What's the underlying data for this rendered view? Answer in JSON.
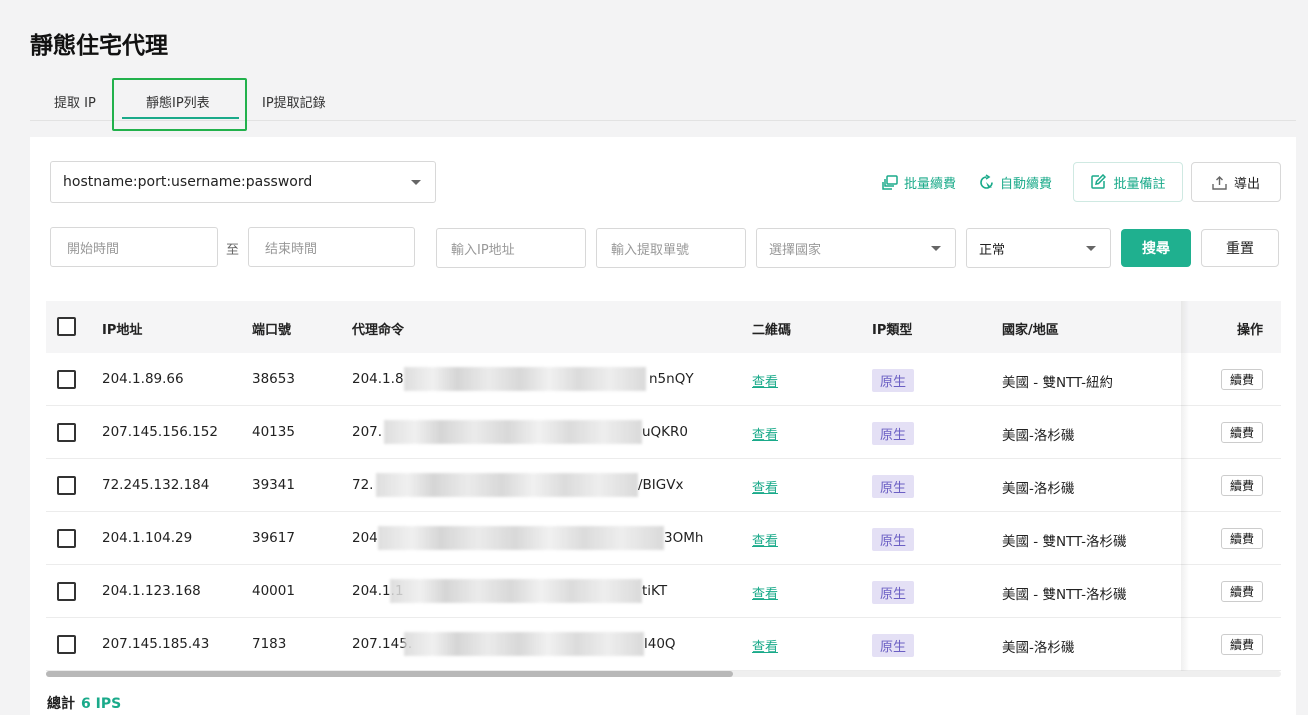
{
  "page": {
    "title": "靜態住宅代理"
  },
  "tabs": [
    {
      "label": "提取 IP"
    },
    {
      "label": "靜態IP列表"
    },
    {
      "label": "IP提取記錄"
    }
  ],
  "toolbar": {
    "format_select": "hostname:port:username:password",
    "bulk_renew": "批量續費",
    "auto_renew": "自動續費",
    "bulk_note": "批量備註",
    "export": "導出"
  },
  "filters": {
    "start_time_placeholder": "開始時間",
    "range_sep": "至",
    "end_time_placeholder": "结束時間",
    "ip_placeholder": "輸入IP地址",
    "order_placeholder": "輸入提取單號",
    "country_placeholder": "選擇國家",
    "status_value": "正常",
    "search": "搜尋",
    "reset": "重置"
  },
  "table": {
    "headers": {
      "ip": "IP地址",
      "port": "端口號",
      "command": "代理命令",
      "qr": "二維碼",
      "ip_type": "IP類型",
      "region": "國家/地區",
      "action": "操作"
    },
    "rows": [
      {
        "ip": "204.1.89.66",
        "port": "38653",
        "cmd_start": "204.1.8",
        "cmd_end": "n5nQY",
        "qr": "查看",
        "type": "原生",
        "region": "美國 - 雙NTT-紐約",
        "action": "續費"
      },
      {
        "ip": "207.145.156.152",
        "port": "40135",
        "cmd_start": "207.",
        "cmd_end": "uQKR0",
        "qr": "查看",
        "type": "原生",
        "region": "美國-洛杉磯",
        "action": "續費"
      },
      {
        "ip": "72.245.132.184",
        "port": "39341",
        "cmd_start": "72.",
        "cmd_end": "/BIGVx",
        "qr": "查看",
        "type": "原生",
        "region": "美國-洛杉磯",
        "action": "續費"
      },
      {
        "ip": "204.1.104.29",
        "port": "39617",
        "cmd_start": "204",
        "cmd_end": "3OMh",
        "qr": "查看",
        "type": "原生",
        "region": "美國 - 雙NTT-洛杉磯",
        "action": "續費"
      },
      {
        "ip": "204.1.123.168",
        "port": "40001",
        "cmd_start": "204.1.1",
        "cmd_end": "tiKT",
        "qr": "查看",
        "type": "原生",
        "region": "美國 - 雙NTT-洛杉磯",
        "action": "續費"
      },
      {
        "ip": "207.145.185.43",
        "port": "7183",
        "cmd_start": "207.145.",
        "cmd_end": "l40Q",
        "qr": "查看",
        "type": "原生",
        "region": "美國-洛杉磯",
        "action": "續費"
      }
    ]
  },
  "footer": {
    "total_label": "總計",
    "total_count": "6 IPS"
  }
}
